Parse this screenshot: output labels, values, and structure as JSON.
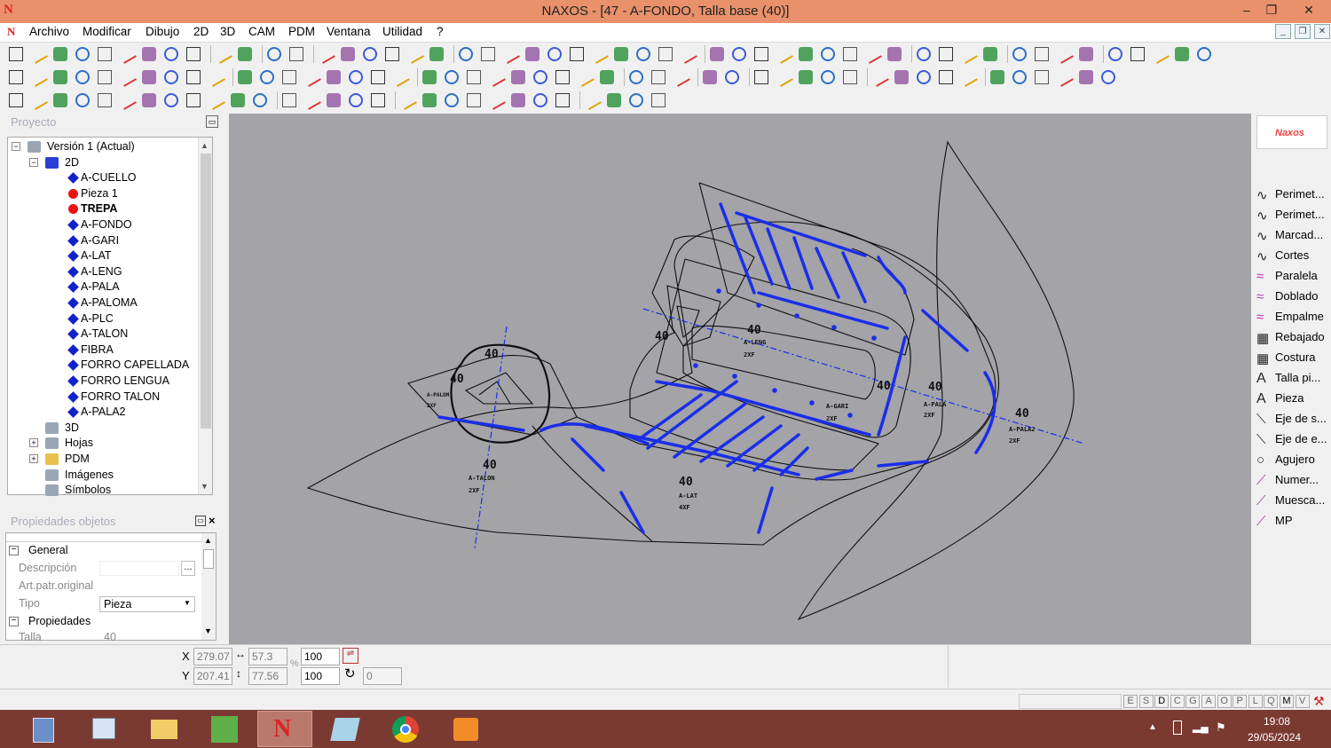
{
  "window": {
    "title": "NAXOS - [47 - A-FONDO, Talla base (40)]",
    "app_icon": "N",
    "min": "–",
    "max": "❐",
    "close": "✕"
  },
  "menu": [
    "Archivo",
    "Modificar",
    "Dibujo",
    "2D",
    "3D",
    "CAM",
    "PDM",
    "Ventana",
    "Utilidad",
    "?"
  ],
  "project": {
    "header": "Proyecto",
    "tree": [
      {
        "label": "Versión 1 (Actual)",
        "icon": "version-icon"
      },
      {
        "label": "2D",
        "icon": "diamond-icon"
      },
      {
        "label": "A-CUELLO",
        "icon": "blue-diamond"
      },
      {
        "label": "Pieza 1",
        "icon": "red-dot"
      },
      {
        "label": "TREPA",
        "icon": "red-dot",
        "bold": true
      },
      {
        "label": "A-FONDO",
        "icon": "blue-diamond"
      },
      {
        "label": "A-GARI",
        "icon": "blue-diamond"
      },
      {
        "label": "A-LAT",
        "icon": "blue-diamond"
      },
      {
        "label": "A-LENG",
        "icon": "blue-diamond"
      },
      {
        "label": "A-PALA",
        "icon": "blue-diamond"
      },
      {
        "label": "A-PALOMA",
        "icon": "blue-diamond"
      },
      {
        "label": "A-PLC",
        "icon": "blue-diamond"
      },
      {
        "label": "A-TALON",
        "icon": "blue-diamond"
      },
      {
        "label": "FIBRA",
        "icon": "blue-diamond"
      },
      {
        "label": "FORRO CAPELLADA",
        "icon": "blue-diamond"
      },
      {
        "label": "FORRO LENGUA",
        "icon": "blue-diamond"
      },
      {
        "label": "FORRO TALON",
        "icon": "blue-diamond"
      },
      {
        "label": "A-PALA2",
        "icon": "blue-diamond"
      },
      {
        "label": "3D",
        "icon": "3d-icon"
      },
      {
        "label": "Hojas",
        "icon": "sheets-icon"
      },
      {
        "label": "PDM",
        "icon": "folder-icon"
      },
      {
        "label": "Imágenes",
        "icon": "images-icon"
      },
      {
        "label": "Símbolos",
        "icon": "symbols-icon"
      }
    ]
  },
  "properties": {
    "header": "Propiedades objetos",
    "group_general": "General",
    "descripcion_label": "Descripción",
    "descripcion_btn": "...",
    "artpatr_label": "Art.patr.original",
    "tipo_label": "Tipo",
    "tipo_value": "Pieza",
    "group_props": "Propiedades",
    "talla_label": "Talla",
    "talla_value": "40"
  },
  "canvas": {
    "labels": [
      {
        "t": "40",
        "s": "size"
      },
      {
        "t": "40",
        "s": "size"
      },
      {
        "t": "40",
        "s": "size"
      },
      {
        "t": "40",
        "s": "size"
      },
      {
        "t": "40",
        "s": "size"
      },
      {
        "t": "40",
        "s": "size"
      },
      {
        "t": "40",
        "s": "size"
      },
      {
        "t": "40",
        "s": "size"
      },
      {
        "t": "40",
        "s": "size"
      },
      {
        "t": "40",
        "s": "size"
      },
      {
        "t": "A-LENG",
        "s": "name"
      },
      {
        "t": "2XF",
        "s": "name"
      },
      {
        "t": "A-GARI",
        "s": "name"
      },
      {
        "t": "2XF",
        "s": "name"
      },
      {
        "t": "A-PALA",
        "s": "name"
      },
      {
        "t": "2XF",
        "s": "name"
      },
      {
        "t": "A-PALA2",
        "s": "name"
      },
      {
        "t": "2XF",
        "s": "name"
      },
      {
        "t": "A-TALON",
        "s": "name"
      },
      {
        "t": "2XF",
        "s": "name"
      },
      {
        "t": "A-LAT",
        "s": "name"
      },
      {
        "t": "4XF",
        "s": "name"
      },
      {
        "t": "A-PALOM",
        "s": "name"
      },
      {
        "t": "2XF",
        "s": "name"
      }
    ]
  },
  "right_panel": {
    "logo": "Naxos",
    "items": [
      "Perimet...",
      "Perimet...",
      "Marcad...",
      "Cortes",
      "Paralela",
      "Doblado",
      "Empalme",
      "Rebajado",
      "Costura",
      "Talla pi...",
      "Pieza",
      "Eje de s...",
      "Eje de e...",
      "Agujero",
      "Numer...",
      "Muesca...",
      "MP"
    ]
  },
  "coords": {
    "x_label": "X",
    "y_label": "Y",
    "x": "279.07",
    "y": "207.41",
    "w": "57.3",
    "h": "77.56",
    "sx": "100",
    "sy": "100",
    "pct": "%",
    "rot": "0"
  },
  "status": {
    "letters": [
      "E",
      "S",
      "D",
      "C",
      "G",
      "A",
      "O",
      "P",
      "L",
      "Q",
      "M",
      "V"
    ]
  },
  "taskbar": {
    "time": "19:08",
    "date": "29/05/2024"
  },
  "colors": {
    "titlebar": "#e8916a",
    "canvas": "#a3a3a8",
    "pattern_blue": "#1a2ee8",
    "taskbar": "#7a3a32"
  }
}
